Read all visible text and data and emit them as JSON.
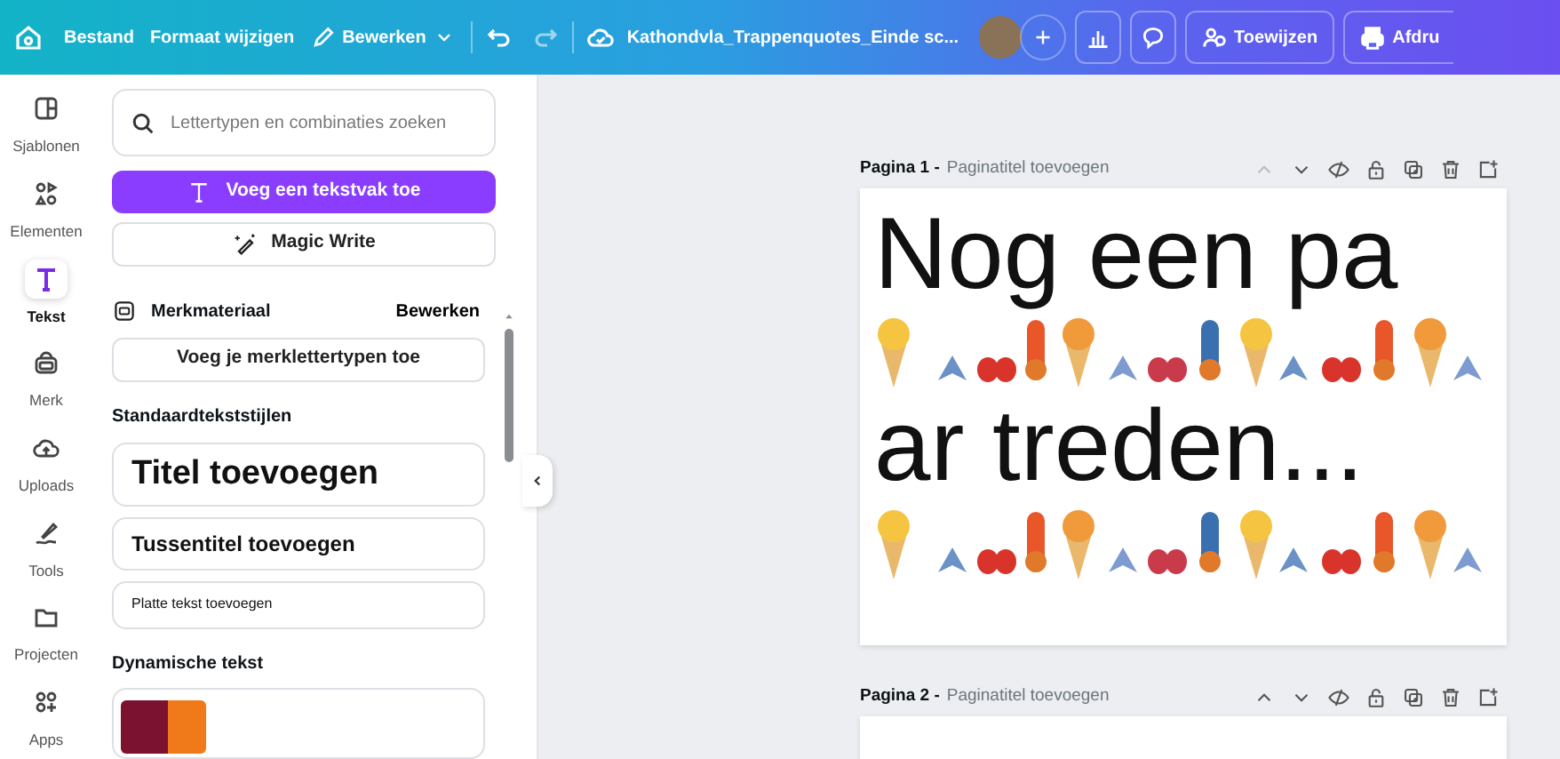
{
  "topbar": {
    "menu": [
      "Bestand",
      "Formaat wijzigen"
    ],
    "edit_label": "Bewerken",
    "document_title": "Kathondvla_Trappenquotes_Einde sc...",
    "assign_label": "Toewijzen",
    "print_label": "Afdru"
  },
  "rail": [
    {
      "label": "Sjablonen",
      "selected": false
    },
    {
      "label": "Elementen",
      "selected": false
    },
    {
      "label": "Tekst",
      "selected": true
    },
    {
      "label": "Merk",
      "selected": false
    },
    {
      "label": "Uploads",
      "selected": false
    },
    {
      "label": "Tools",
      "selected": false
    },
    {
      "label": "Projecten",
      "selected": false
    },
    {
      "label": "Apps",
      "selected": false
    }
  ],
  "panel": {
    "search_placeholder": "Lettertypen en combinaties zoeken",
    "add_textbox_label": "Voeg een tekstvak toe",
    "magic_write_label": "Magic Write",
    "brand": {
      "title": "Merkmateriaal",
      "edit_label": "Bewerken",
      "add_fonts_label": "Voeg je merklettertypen toe"
    },
    "styles_heading": "Standaardtekststijlen",
    "styles": [
      {
        "kind": "title",
        "label": "Titel toevoegen"
      },
      {
        "kind": "subtitle",
        "label": "Tussentitel toevoegen"
      },
      {
        "kind": "body",
        "label": "Platte tekst toevoegen"
      }
    ],
    "dynamic_heading": "Dynamische tekst"
  },
  "pages": [
    {
      "number_label": "Pagina 1 -",
      "title_placeholder": "Paginatitel toevoegen",
      "move_up_disabled": true,
      "lines": [
        "Nog een pa",
        "ar treden..."
      ]
    },
    {
      "number_label": "Pagina 2 -",
      "title_placeholder": "Paginatitel toevoegen",
      "move_up_disabled": false
    }
  ]
}
